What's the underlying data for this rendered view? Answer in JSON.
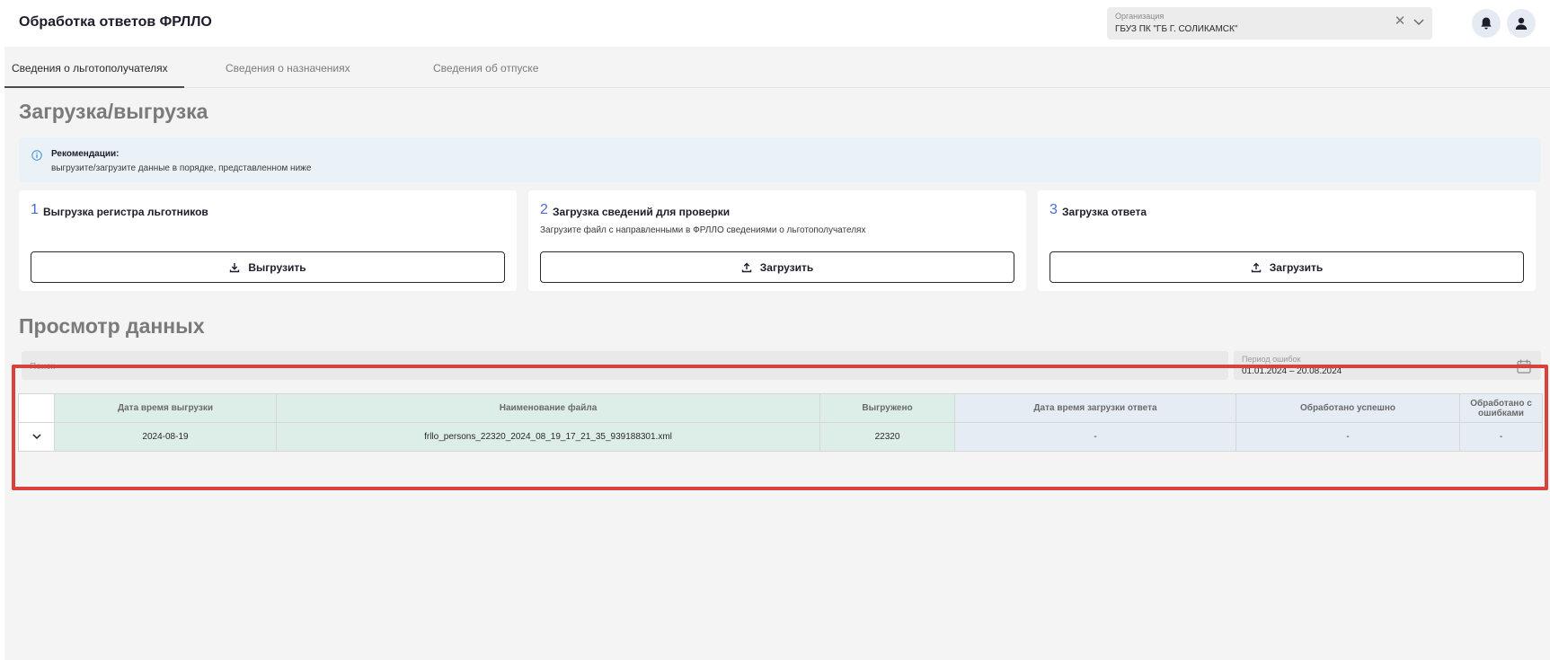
{
  "header": {
    "title": "Обработка ответов ФРЛЛО",
    "org": {
      "label": "Организация",
      "value": "ГБУЗ ПК \"ГБ Г. СОЛИКАМСК\""
    }
  },
  "tabs": [
    {
      "label": "Сведения о льготополучателях",
      "active": true
    },
    {
      "label": "Сведения о назначениях",
      "active": false
    },
    {
      "label": "Сведения об отпуске",
      "active": false
    }
  ],
  "upload_section": {
    "title": "Загрузка/выгрузка",
    "recommendation": {
      "title": "Рекомендации:",
      "text": "выгрузите/загрузите данные в порядке, представленном ниже"
    },
    "cards": [
      {
        "num": "1",
        "title": "Выгрузка регистра льготников",
        "desc": "",
        "button": "Выгрузить",
        "icon": "download-icon"
      },
      {
        "num": "2",
        "title": "Загрузка сведений для проверки",
        "desc": "Загрузите файл с направленными в ФРЛЛО сведениями о льготополучателях",
        "button": "Загрузить",
        "icon": "upload-icon"
      },
      {
        "num": "3",
        "title": "Загрузка ответа",
        "desc": "",
        "button": "Загрузить",
        "icon": "upload-icon"
      }
    ]
  },
  "data_section": {
    "title": "Просмотр данных",
    "search_placeholder": "Поиск",
    "period": {
      "label": "Период ошибок",
      "value": "01.01.2024 – 20.08.2024"
    },
    "table": {
      "columns": [
        "",
        "Дата время выгрузки",
        "Наименование файла",
        "Выгружено",
        "Дата время загрузки ответа",
        "Обработано успешно",
        "Обработано с ошибками"
      ],
      "rows": [
        [
          "",
          "2024-08-19",
          "frllo_persons_22320_2024_08_19_17_21_35_939188301.xml",
          "22320",
          "-",
          "-",
          "-"
        ]
      ]
    }
  },
  "colors": {
    "accent": "#4a6ad0",
    "highlight": "#d9423a",
    "header_green": "#ddede8",
    "header_blue": "#e6ecf4"
  }
}
